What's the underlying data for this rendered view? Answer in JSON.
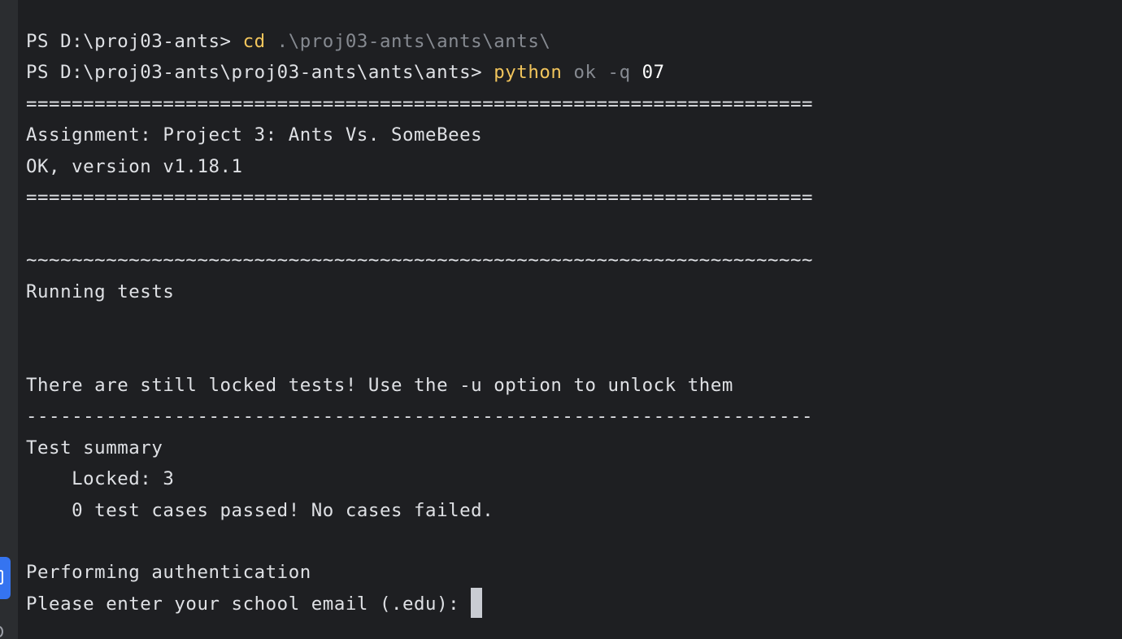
{
  "terminal": {
    "prompt1": "PS D:\\proj03-ants> ",
    "cmd1_name": "cd",
    "cmd1_arg": " .\\proj03-ants\\ants\\ants\\",
    "prompt2": "PS D:\\proj03-ants\\proj03-ants\\ants\\ants> ",
    "cmd2_name": "python",
    "cmd2_arg1": " ok",
    "cmd2_flag": " -q",
    "cmd2_arg2": " 07",
    "separator_eq": "=====================================================================",
    "assignment": "Assignment: Project 3: Ants Vs. SomeBees",
    "version": "OK, version v1.18.1",
    "separator_tilde": "~~~~~~~~~~~~~~~~~~~~~~~~~~~~~~~~~~~~~~~~~~~~~~~~~~~~~~~~~~~~~~~~~~~~~",
    "running": "Running tests",
    "locked_msg": "There are still locked tests! Use the -u option to unlock them",
    "separator_dash": "---------------------------------------------------------------------",
    "summary_title": "Test summary",
    "locked_count": "    Locked: 3",
    "passed_msg": "    0 test cases passed! No cases failed.",
    "auth": "Performing authentication",
    "email_prompt": "Please enter your school email (.edu): "
  },
  "colors": {
    "background": "#1e1f22",
    "gutter": "#2b2d30",
    "text": "#dfe1e5",
    "command": "#e5c07b",
    "argument": "#868a91",
    "highlight": "#ffffff",
    "tab_accent": "#3574f0"
  }
}
